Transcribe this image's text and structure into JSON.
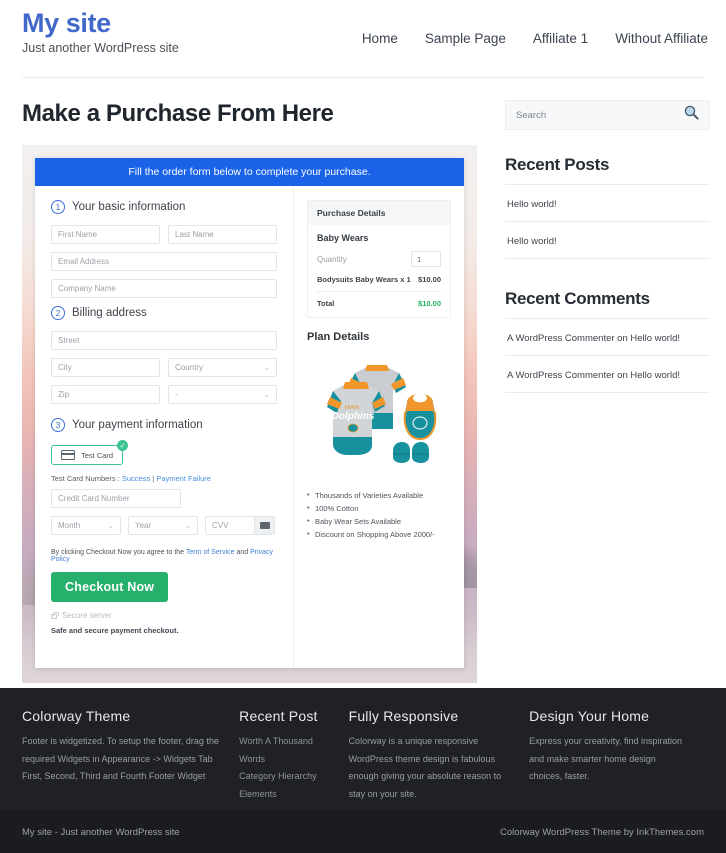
{
  "header": {
    "site_title": "My site",
    "tagline": "Just another WordPress site",
    "nav": [
      {
        "label": "Home"
      },
      {
        "label": "Sample Page"
      },
      {
        "label": "Affiliate 1"
      },
      {
        "label": "Without Affiliate"
      }
    ]
  },
  "main": {
    "page_title": "Make a Purchase From Here",
    "order_banner": "Fill the order form below to complete your purchase.",
    "steps": {
      "step1_num": "1",
      "step1_label": "Your basic information",
      "step2_num": "2",
      "step2_label": "Billing address",
      "step3_num": "3",
      "step3_label": "Your payment information"
    },
    "fields": {
      "first_name": "First Name",
      "last_name": "Last Name",
      "email": "Email Address",
      "company": "Company Name",
      "street": "Street",
      "city": "City",
      "country": "Country",
      "zip": "Zip",
      "state": "-",
      "credit_card": "Credit Card Number",
      "month": "Month",
      "year": "Year",
      "cvv": "CVV"
    },
    "payment": {
      "test_card_label": "Test Card",
      "test_numbers_prefix": "Test Card Numbers : ",
      "test_success": "Success",
      "test_separator": " | ",
      "test_failure": "Payment Failure",
      "terms_prefix": "By clicking Checkout Now you agree to the ",
      "terms_link": "Term of Service",
      "terms_and": " and ",
      "privacy_link": "Privacy Policy",
      "checkout_button": "Checkout Now",
      "secure_server": "Secure server",
      "safe_note": "Safe and secure payment checkout."
    },
    "purchase_details": {
      "heading": "Purchase Details",
      "product": "Baby Wears",
      "quantity_label": "Quantity",
      "quantity_value": "1",
      "line_item_label": "Bodysuits Baby Wears x 1",
      "line_item_amount": "$10.00",
      "total_label": "Total",
      "total_amount": "$10.00"
    },
    "plan": {
      "heading": "Plan Details",
      "image_brand": "Dolphins",
      "image_brand_sub": "MIAMI",
      "bullets": [
        "Thousands of Varieties Available",
        "100% Cotton",
        "Baby Wear Sets Available",
        "Discount on Shopping Above 2000/-"
      ]
    }
  },
  "sidebar": {
    "search_placeholder": "Search",
    "recent_posts_title": "Recent Posts",
    "recent_posts": [
      {
        "label": "Hello world!"
      },
      {
        "label": "Hello world!"
      }
    ],
    "recent_comments_title": "Recent Comments",
    "recent_comments": [
      {
        "label": "A WordPress Commenter on Hello world!"
      },
      {
        "label": "A WordPress Commenter on Hello world!"
      }
    ]
  },
  "footer": {
    "col1_title": "Colorway Theme",
    "col1_text": "Footer is widgetized. To setup the footer, drag the required Widgets in Appearance -> Widgets Tab First, Second, Third and Fourth Footer Widget",
    "col2_title": "Recent Post",
    "col2_items": [
      {
        "label": "Worth A Thousand Words"
      },
      {
        "label": "Category Hierarchy"
      },
      {
        "label": "Elements"
      }
    ],
    "col3_title": "Fully Responsive",
    "col3_text": "Colorway is a unique responsive WordPress theme design is fabulous enough giving your absolute reason to stay on your site.",
    "col4_title": "Design Your Home",
    "col4_text": "Express your creativity, find inspiration and make smarter home design choices, faster.",
    "bottom_left": "My site - Just another WordPress site",
    "bottom_right": "Colorway WordPress Theme by InkThemes.com"
  },
  "colors": {
    "brand_blue": "#4169c9",
    "banner_blue": "#1a62e8",
    "checkout_green": "#27b06c",
    "total_green": "#1fb45f",
    "footer_dark": "#1f2124",
    "footer_bottom_dark": "#1a1c1f"
  }
}
